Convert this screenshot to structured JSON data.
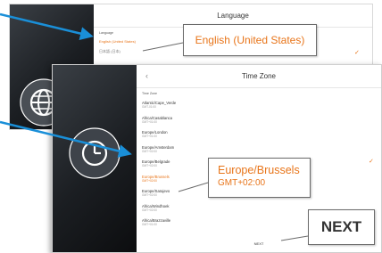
{
  "language_screen": {
    "title": "Language",
    "section_label": "Language",
    "selected_language": "English (United States)",
    "next_row_partial": "日本語 (日本)"
  },
  "timezone_screen": {
    "title": "Time Zone",
    "section_label": "Time Zone",
    "items": [
      {
        "name": "Atlantic/Cape_Verde",
        "offset": "GMT-01:00"
      },
      {
        "name": "Africa/Casablanca",
        "offset": "GMT+01:00"
      },
      {
        "name": "Europe/London",
        "offset": "GMT+01:00"
      },
      {
        "name": "Europe/Amsterdam",
        "offset": "GMT+02:00"
      },
      {
        "name": "Europe/Belgrade",
        "offset": "GMT+02:00"
      },
      {
        "name": "Europe/Brussels",
        "offset": "GMT+02:00"
      },
      {
        "name": "Europe/Sarajevo",
        "offset": "GMT+02:00"
      },
      {
        "name": "Africa/Windhoek",
        "offset": "GMT+02:00"
      },
      {
        "name": "Africa/Brazzaville",
        "offset": "GMT+01:00"
      }
    ],
    "next_label": "NEXT"
  },
  "callouts": {
    "language": "English (United States)",
    "timezone_name": "Europe/Brussels",
    "timezone_offset": "GMT+02:00",
    "next": "NEXT"
  },
  "colors": {
    "accent": "#e8751a",
    "arrow": "#1a8fd8",
    "dark_panel": "#1b1e22"
  },
  "icons": [
    "globe-icon",
    "power-icon",
    "back-chevron-icon",
    "checkmark-icon"
  ]
}
